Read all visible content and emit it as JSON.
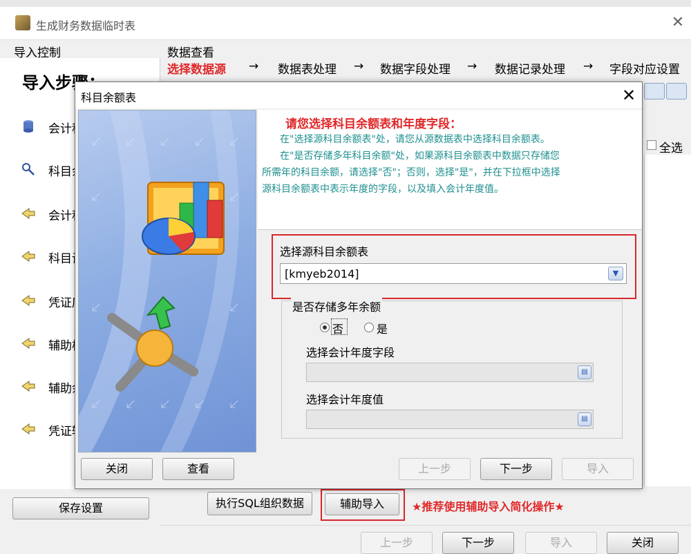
{
  "main_window": {
    "title": "生成财务数据临时表",
    "close_symbol": "✕"
  },
  "left_panel": {
    "group_label": "导入控制",
    "steps_title": "导入步骤：",
    "steps": [
      {
        "label": "会计科目",
        "icon": "database-icon"
      },
      {
        "label": "科目余额",
        "icon": "magnifier-icon"
      },
      {
        "label": "会计科目",
        "icon": "arrow-left-icon"
      },
      {
        "label": "科目设置",
        "icon": "arrow-left-icon"
      },
      {
        "label": "凭证库",
        "icon": "arrow-left-icon"
      },
      {
        "label": "辅助核算",
        "icon": "arrow-left-icon"
      },
      {
        "label": "辅助余额",
        "icon": "arrow-left-icon"
      },
      {
        "label": "凭证辅助",
        "icon": "arrow-left-icon"
      }
    ],
    "save_button": "保存设置"
  },
  "data_view": {
    "group_label": "数据查看",
    "crumbs": [
      "选择数据源",
      "数据表处理",
      "数据字段处理",
      "数据记录处理",
      "字段对应设置"
    ],
    "crumb_arrow": "→",
    "select_all_label": "全选"
  },
  "bottom": {
    "sql_button": "执行SQL组织数据",
    "assist_button": "辅助导入",
    "recommend_text": "★推荐使用辅助导入简化操作★",
    "prev_button": "上一步",
    "next_button": "下一步",
    "import_button": "导入",
    "close_button": "关闭"
  },
  "dialog": {
    "title": "科目余额表",
    "close_symbol": "✕",
    "instructions": {
      "heading": "请您选择科目余额表和年度字段：",
      "lines": [
        "在\"选择源科目余额表\"处，请您从源数据表中选择科目余额表。",
        "在\"是否存储多年科目余额\"处，如果源科目余额表中数据只存储您",
        "所需年的科目余额，请选择\"否\"；否则，选择\"是\"，并在下拉框中选择",
        "源科目余额表中表示年度的字段，以及填入会计年度值。"
      ]
    },
    "source_table_label": "选择源科目余额表",
    "source_table_value": "[kmyeb2014]",
    "multi_year_label": "是否存储多年余额",
    "radio_no": "否",
    "radio_yes": "是",
    "selected_option": "否",
    "year_field_label": "选择会计年度字段",
    "year_value_label": "选择会计年度值",
    "close_button": "关闭",
    "view_button": "查看",
    "prev_button": "上一步",
    "next_button": "下一步",
    "import_button": "导入"
  },
  "colors": {
    "accent_red": "#e0282a",
    "instruction_teal": "#1f8f8f",
    "highlight_frame": "#d7262b"
  }
}
